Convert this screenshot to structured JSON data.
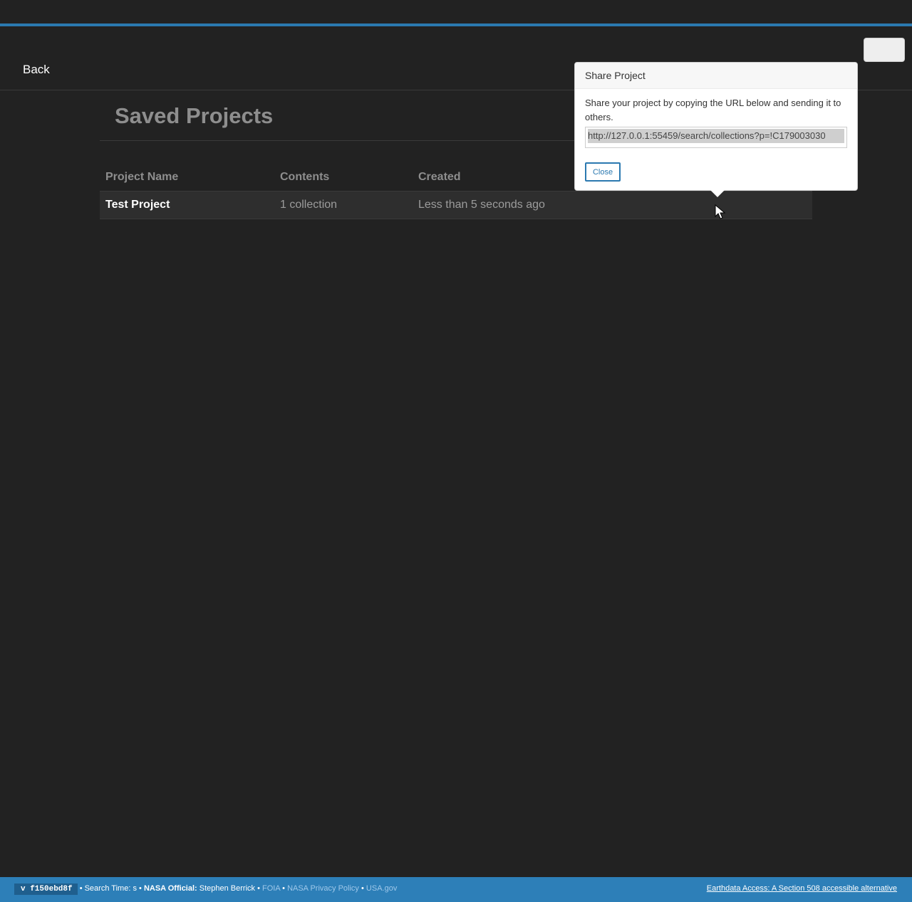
{
  "header": {
    "back_label": "Back"
  },
  "page": {
    "title": "Saved Projects"
  },
  "table": {
    "columns": [
      "Project Name",
      "Contents",
      "Created"
    ],
    "rows": [
      {
        "name": "Test Project",
        "contents": "1 collection",
        "created": "Less than 5 seconds ago"
      }
    ]
  },
  "share_popover": {
    "title": "Share Project",
    "description": "Share your project by copying the URL below and sending it to others.",
    "url": "http://127.0.0.1:55459/search/collections?p=!C179003030",
    "close_label": "Close"
  },
  "footer": {
    "version": "v f150ebd8f",
    "search_time": "• Search Time: s •",
    "official_label": "NASA Official:",
    "official_name": "Stephen Berrick",
    "links": [
      "FOIA",
      "NASA Privacy Policy",
      "USA.gov"
    ],
    "separator": "•",
    "accessible_link": "Earthdata Access: A Section 508 accessible alternative"
  },
  "colors": {
    "background": "#222222",
    "accent": "#2b79b0",
    "footer": "#2d7fb8"
  },
  "icons": [
    "mouse-pointer-icon"
  ]
}
